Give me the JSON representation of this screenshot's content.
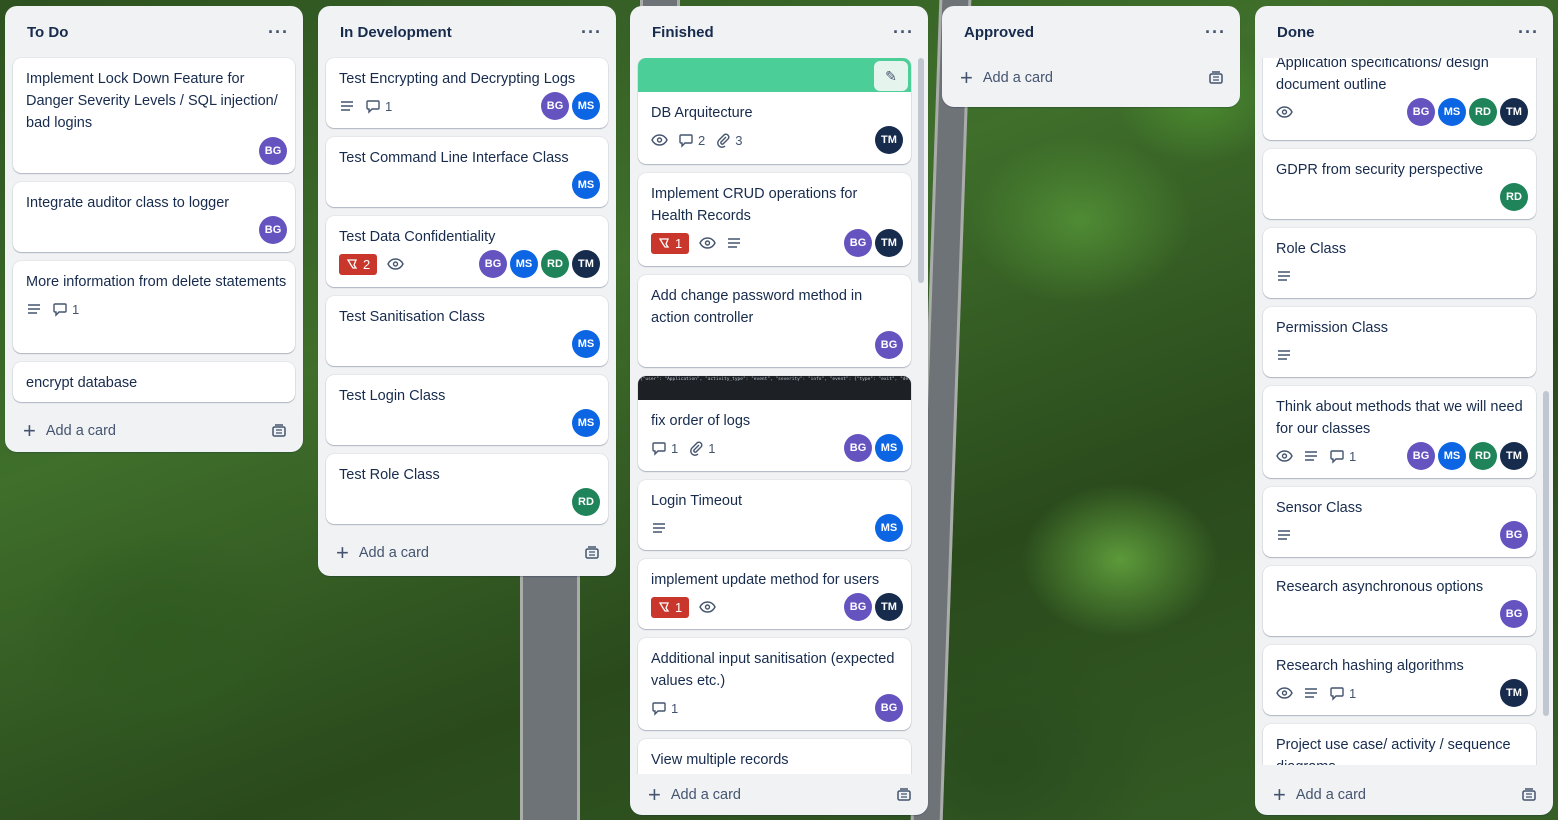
{
  "lists": [
    {
      "title": "To Do",
      "menu": "···",
      "add_label": "Add a card",
      "cards": [
        {
          "title": "Implement Lock Down Feature for Danger Severity Levels / SQL injection/ bad logins",
          "avatars": [
            "BG"
          ]
        },
        {
          "title": "Integrate auditor class to logger",
          "avatars": [
            "BG"
          ]
        },
        {
          "title": "More information from delete statements",
          "description": true,
          "comments": "1"
        },
        {
          "title": "encrypt database"
        }
      ]
    },
    {
      "title": "In Development",
      "menu": "···",
      "add_label": "Add a card",
      "cards": [
        {
          "title": "Test Encrypting and Decrypting Logs",
          "description": true,
          "comments": "1",
          "avatars": [
            "BG",
            "MS"
          ]
        },
        {
          "title": "Test Command Line Interface Class",
          "avatars": [
            "MS"
          ]
        },
        {
          "title": "Test Data Confidentiality",
          "votes": "2",
          "watch": true,
          "avatars": [
            "BG",
            "MS",
            "RD",
            "TM"
          ]
        },
        {
          "title": "Test Sanitisation Class",
          "avatars": [
            "MS"
          ]
        },
        {
          "title": "Test Login Class",
          "avatars": [
            "MS"
          ]
        },
        {
          "title": "Test Role Class",
          "avatars": [
            "RD"
          ]
        }
      ]
    },
    {
      "title": "Finished",
      "menu": "···",
      "add_label": "Add a card",
      "cards": [
        {
          "title": "DB Arquitecture",
          "cover": "green",
          "watch": true,
          "comments": "2",
          "attachments": "3",
          "avatars": [
            "TM"
          ]
        },
        {
          "title": "Implement CRUD operations for Health Records",
          "votes": "1",
          "watch": true,
          "description": true,
          "avatars": [
            "BG",
            "TM"
          ]
        },
        {
          "title": "Add change password method in action controller",
          "avatars": [
            "BG"
          ]
        },
        {
          "title": "fix order of logs",
          "cover": "log",
          "comments": "1",
          "attachments": "1",
          "avatars": [
            "BG",
            "MS"
          ]
        },
        {
          "title": "Login Timeout",
          "description": true,
          "avatars": [
            "MS"
          ]
        },
        {
          "title": "implement update method for users",
          "votes": "1",
          "watch": true,
          "avatars": [
            "BG",
            "TM"
          ]
        },
        {
          "title": "Additional input sanitisation (expected values etc.)",
          "comments": "1",
          "avatars": [
            "BG"
          ]
        },
        {
          "title": "View multiple records"
        }
      ],
      "log_cover_text": "{\"user\": \"Application\", \"activity_type\": \"event\", \"severity\": \"info\", \"event\": {\"type\": \"exit\", \"details\": {\"event\"\n{\"user\": \"Brad\", \"activity_type\": \"action\", \"action\": {\"type\": \"View Health Records\", \"parameters\": {\"exit\"\n{\"user\": \"test_name\", \"activity_type\": \"event\", \"severity\": \"info\", \"event\": {\"type\": \"successful_login\", \"details\"\n{\"user\": \"Application\", \"activity_type\": \"event\", \"severity\": \"info\", \"event\": {\"type\": \"exit\", \"details\": {\"event\""
    },
    {
      "title": "Approved",
      "menu": "···",
      "add_label": "Add a card",
      "cards": []
    },
    {
      "title": "Done",
      "menu": "···",
      "add_label": "Add a card",
      "cards": [
        {
          "title": "Application specifications/ design document outline",
          "watch": true,
          "avatars": [
            "BG",
            "MS",
            "RD",
            "TM"
          ]
        },
        {
          "title": "GDPR from security perspective",
          "avatars": [
            "RD"
          ]
        },
        {
          "title": "Role Class",
          "description": true
        },
        {
          "title": "Permission Class",
          "description": true
        },
        {
          "title": "Think about methods that we will need for our classes",
          "watch": true,
          "description": true,
          "comments": "1",
          "avatars": [
            "BG",
            "MS",
            "RD",
            "TM"
          ]
        },
        {
          "title": "Sensor Class",
          "description": true,
          "avatars": [
            "BG"
          ]
        },
        {
          "title": "Research asynchronous options",
          "avatars": [
            "BG"
          ]
        },
        {
          "title": "Research hashing algorithms",
          "watch": true,
          "description": true,
          "comments": "1",
          "avatars": [
            "TM"
          ]
        },
        {
          "title": "Project use case/ activity / sequence diagrams"
        }
      ]
    }
  ],
  "colors": {
    "list_bg": "#f1f2f4",
    "card_bg": "#ffffff",
    "avatar_BG": "#6554c0",
    "avatar_MS": "#0c66e4",
    "avatar_RD": "#1f845a",
    "avatar_TM": "#172b4d",
    "vote_badge": "#c9372c",
    "cover_green": "#4bce97"
  },
  "icons": {
    "menu": "ellipsis-icon",
    "add": "plus-icon",
    "template": "card-template-icon",
    "description": "description-lines-icon",
    "comments": "comment-icon",
    "attachments": "paperclip-icon",
    "watch": "eye-icon",
    "votes": "thumbs-down-icon",
    "edit": "pencil-icon"
  }
}
